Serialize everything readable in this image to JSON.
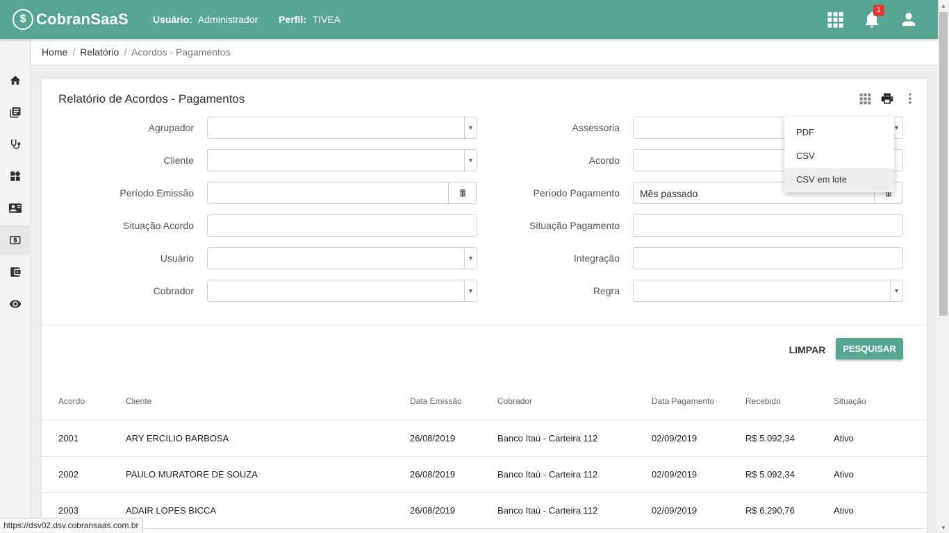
{
  "app": {
    "logo_text": "CobranSaaS",
    "user_label": "Usuário:",
    "user_value": "Administrador",
    "profile_label": "Perfil:",
    "profile_value": "TIVEA",
    "notification_count": "1",
    "accent_color": "#57a694"
  },
  "sidebar": {
    "items": [
      "home-icon",
      "library-icon",
      "stethoscope-icon",
      "dashboard-icon",
      "contacts-icon",
      "money-icon",
      "wallet-icon",
      "eye-icon"
    ],
    "active_index": 5
  },
  "breadcrumb": {
    "items": [
      "Home",
      "Relatório",
      "Acordos - Pagamentos"
    ]
  },
  "card": {
    "title": "Relatório de Acordos - Pagamentos"
  },
  "filters": {
    "agrupador": "Agrupador",
    "cliente": "Cliente",
    "periodo_emissao": "Período Emissão",
    "situacao_acordo": "Situação Acordo",
    "usuario": "Usuário",
    "cobrador": "Cobrador",
    "assessoria": "Assessoria",
    "acordo": "Acordo",
    "periodo_pagamento": "Período Pagamento",
    "periodo_pagamento_value": "Mês passado",
    "situacao_pagamento": "Situação Pagamento",
    "integracao": "Integração",
    "regra": "Regra"
  },
  "actions": {
    "clear": "LIMPAR",
    "search": "PESQUISAR"
  },
  "export_menu": {
    "items": [
      "PDF",
      "CSV",
      "CSV em lote"
    ],
    "hover_index": 2
  },
  "table": {
    "headers": [
      "Acordo",
      "Cliente",
      "Data Emissão",
      "Cobrador",
      "Data Pagamento",
      "Recebido",
      "Situação"
    ],
    "rows": [
      [
        "2001",
        "ARY ERCILIO BARBOSA",
        "26/08/2019",
        "Banco Itaú - Carteira 112",
        "02/09/2019",
        "R$ 5.092,34",
        "Ativo"
      ],
      [
        "2002",
        "PAULO MURATORE DE SOUZA",
        "26/08/2019",
        "Banco Itaú - Carteira 112",
        "02/09/2019",
        "R$ 5.092,34",
        "Ativo"
      ],
      [
        "2003",
        "ADAIR LOPES BICCA",
        "26/08/2019",
        "Banco Itaú - Carteira 112",
        "02/09/2019",
        "R$ 6.290,76",
        "Ativo"
      ]
    ]
  },
  "status_url": "https://dsv02.dsv.cobransaas.com.br"
}
